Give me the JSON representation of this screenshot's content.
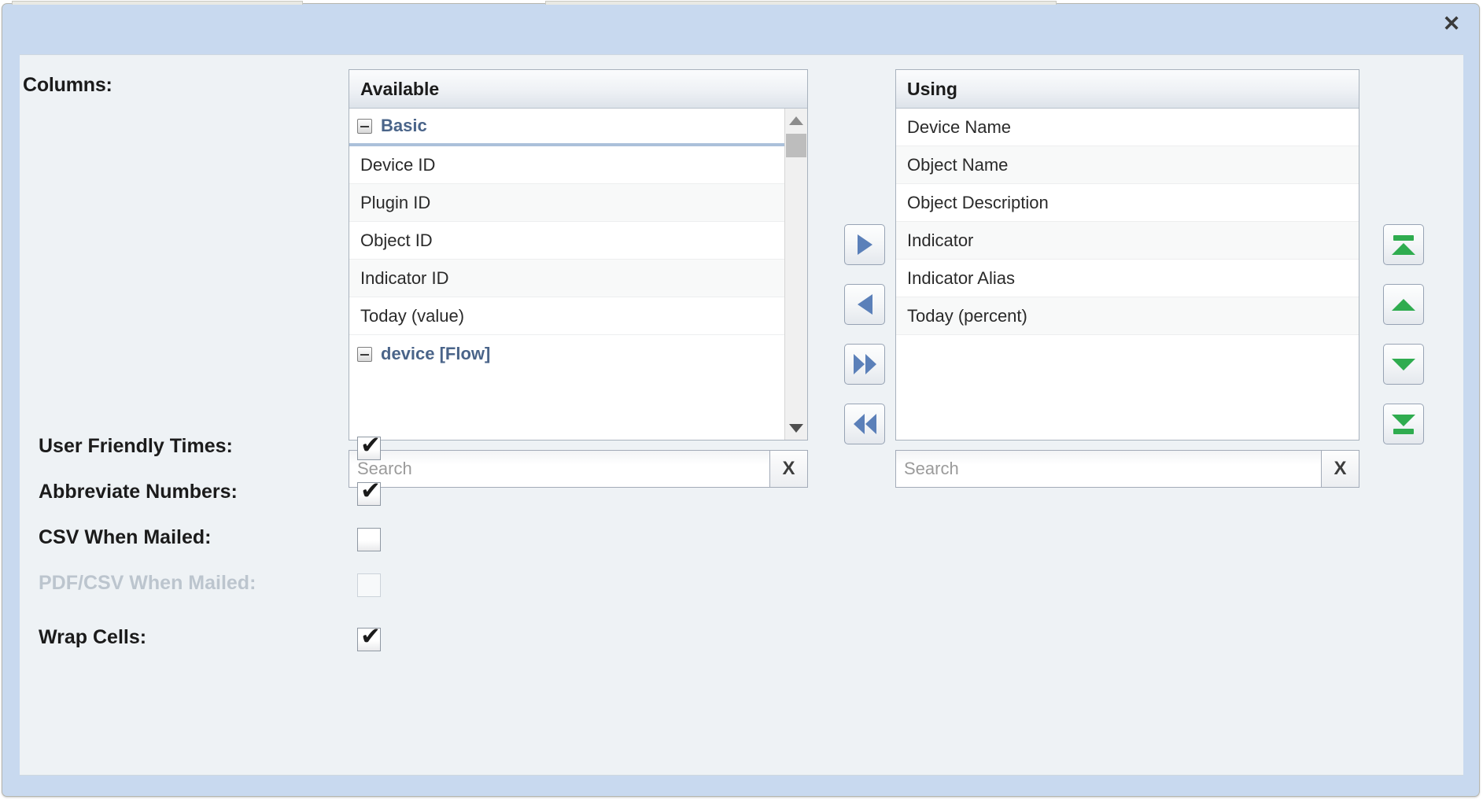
{
  "dialog": {
    "close_label": "✕",
    "columns_label": "Columns:"
  },
  "available_panel": {
    "header": "Available",
    "search_placeholder": "Search",
    "search_value": "",
    "clear_label": "X",
    "items": [
      {
        "label": "Basic",
        "type": "group"
      },
      {
        "label": "Device ID",
        "type": "item"
      },
      {
        "label": "Plugin ID",
        "type": "item"
      },
      {
        "label": "Object ID",
        "type": "item"
      },
      {
        "label": "Indicator ID",
        "type": "item"
      },
      {
        "label": "Today (value)",
        "type": "item"
      },
      {
        "label": "device [Flow]",
        "type": "group2"
      }
    ]
  },
  "using_panel": {
    "header": "Using",
    "search_placeholder": "Search",
    "search_value": "",
    "clear_label": "X",
    "items": [
      {
        "label": "Device Name"
      },
      {
        "label": "Object Name"
      },
      {
        "label": "Object Description"
      },
      {
        "label": "Indicator"
      },
      {
        "label": "Indicator Alias"
      },
      {
        "label": "Today (percent)"
      }
    ]
  },
  "transfer_buttons": [
    {
      "name": "move-right-button",
      "icon": "triangle-right-icon"
    },
    {
      "name": "move-left-button",
      "icon": "triangle-left-icon"
    },
    {
      "name": "move-all-right-button",
      "icon": "double-triangle-right-icon"
    },
    {
      "name": "move-all-left-button",
      "icon": "double-triangle-left-icon"
    }
  ],
  "order_buttons": [
    {
      "name": "move-to-top-button",
      "icon": "bar-triangle-up-icon"
    },
    {
      "name": "move-up-button",
      "icon": "triangle-up-icon"
    },
    {
      "name": "move-down-button",
      "icon": "triangle-down-icon"
    },
    {
      "name": "move-to-bottom-button",
      "icon": "triangle-down-bar-icon"
    }
  ],
  "options": [
    {
      "label": "User Friendly Times:",
      "checked": true,
      "disabled": false,
      "name": "user-friendly-times"
    },
    {
      "label": "Abbreviate Numbers:",
      "checked": true,
      "disabled": false,
      "name": "abbreviate-numbers"
    },
    {
      "label": "CSV When Mailed:",
      "checked": false,
      "disabled": false,
      "name": "csv-when-mailed"
    },
    {
      "label": "PDF/CSV When Mailed:",
      "checked": false,
      "disabled": true,
      "name": "pdf-csv-when-mailed"
    },
    {
      "label": "Wrap Cells:",
      "checked": true,
      "disabled": false,
      "name": "wrap-cells"
    }
  ],
  "colors": {
    "dialog_chrome": "#c8d9ef",
    "panel_bg": "#eef2f5",
    "group_text": "#4a6489",
    "arrow_blue": "#5b80b9",
    "arrow_green": "#2fac4f",
    "disabled_text": "#bcc5ce"
  },
  "check_glyph": "✔"
}
